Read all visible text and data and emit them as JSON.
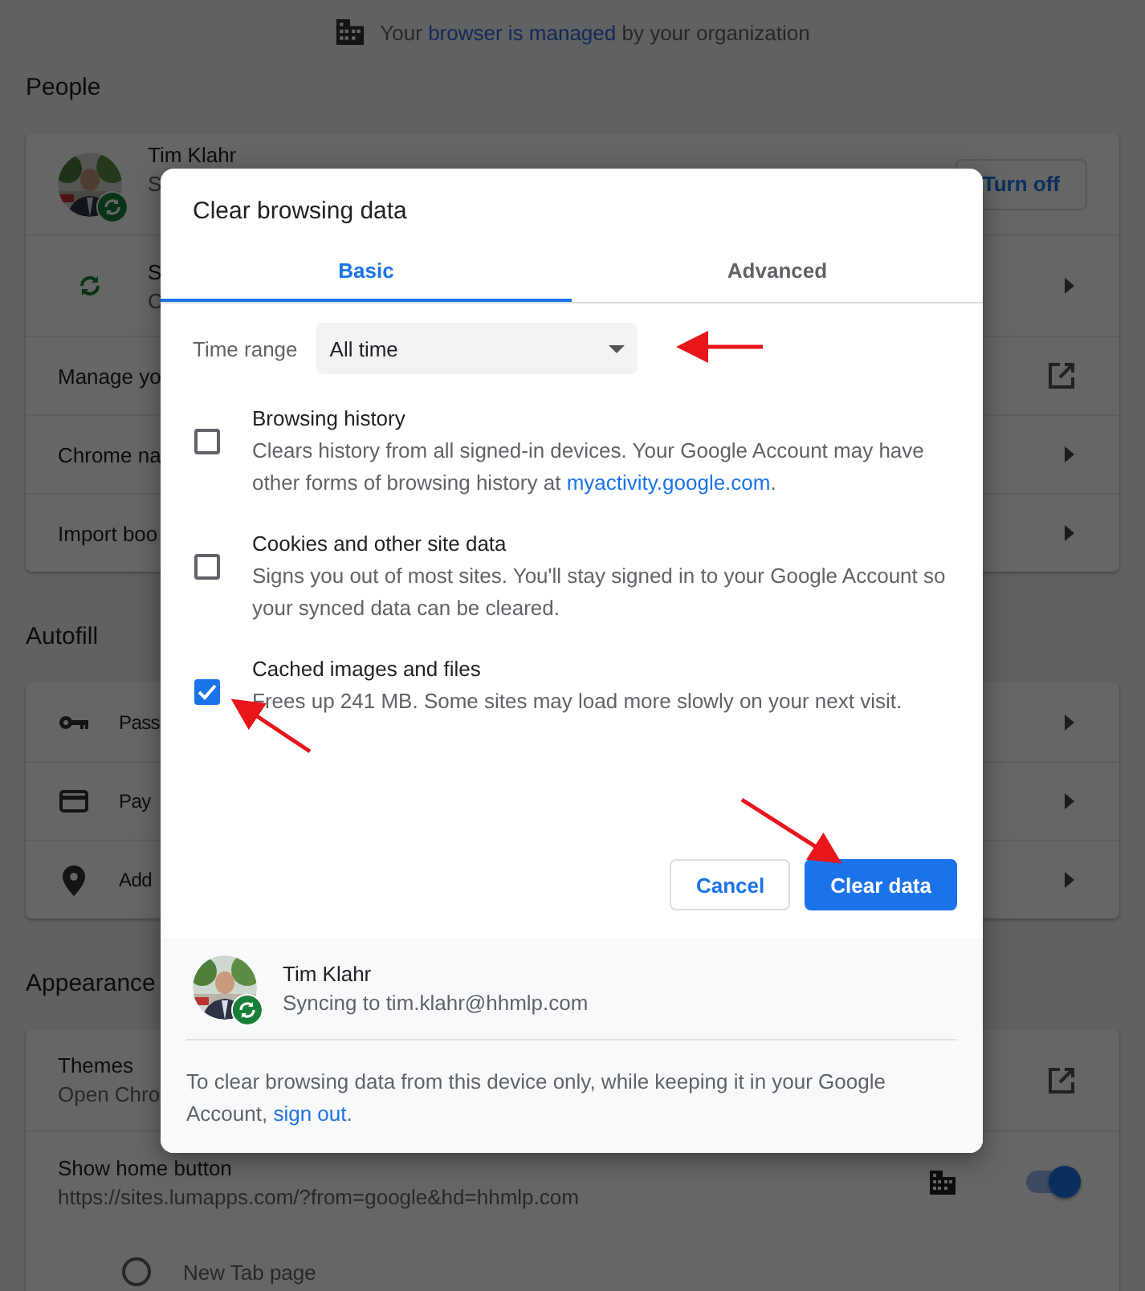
{
  "banner": {
    "before": "Your ",
    "link": "browser is managed",
    "after": " by your organization"
  },
  "people": {
    "heading": "People",
    "profile": {
      "name": "Tim Klahr",
      "sub": "S",
      "button": "Turn off"
    },
    "rows": [
      {
        "kind": "sync",
        "title": "S",
        "sub": "C"
      },
      {
        "kind": "external",
        "title": "Manage yo"
      },
      {
        "kind": "arrow",
        "title": "Chrome na"
      },
      {
        "kind": "arrow",
        "title": "Import boo"
      }
    ]
  },
  "autofill": {
    "heading": "Autofill",
    "rows": [
      {
        "kind": "key",
        "title": "Pass"
      },
      {
        "kind": "card",
        "title": "Pay"
      },
      {
        "kind": "pin",
        "title": "Add"
      }
    ]
  },
  "appearance": {
    "heading": "Appearance",
    "rows": [
      {
        "kind": "external",
        "title": "Themes",
        "sub": "Open Chro"
      },
      {
        "kind": "toggle",
        "title": "Show home button",
        "sub": "https://sites.lumapps.com/?from=google&hd=hhmlp.com",
        "on": true
      }
    ],
    "radio": {
      "label": "New Tab page",
      "selected": false
    }
  },
  "dialog": {
    "title": "Clear browsing data",
    "tabs": [
      {
        "label": "Basic",
        "selected": true
      },
      {
        "label": "Advanced",
        "selected": false
      }
    ],
    "time_range": {
      "label": "Time range",
      "value": "All time"
    },
    "options": [
      {
        "title": "Browsing history",
        "desc": "Clears history from all signed-in devices. Your Google Account may have other forms of browsing history at ",
        "link": "myactivity.google.com",
        "after": ".",
        "checked": false
      },
      {
        "title": "Cookies and other site data",
        "desc": "Signs you out of most sites. You'll stay signed in to your Google Account so your synced data can be cleared.",
        "checked": false
      },
      {
        "title": "Cached images and files",
        "desc": "Frees up 241 MB. Some sites may load more slowly on your next visit.",
        "checked": true
      }
    ],
    "buttons": [
      {
        "label": "Cancel",
        "kind": "secondary"
      },
      {
        "label": "Clear data",
        "kind": "primary"
      }
    ],
    "account": {
      "name": "Tim Klahr",
      "status": "Syncing to tim.klahr@hhmlp.com"
    },
    "note": {
      "text": "To clear browsing data from this device only, while keeping it in your Google Account, ",
      "link": "sign out",
      "after": "."
    }
  }
}
